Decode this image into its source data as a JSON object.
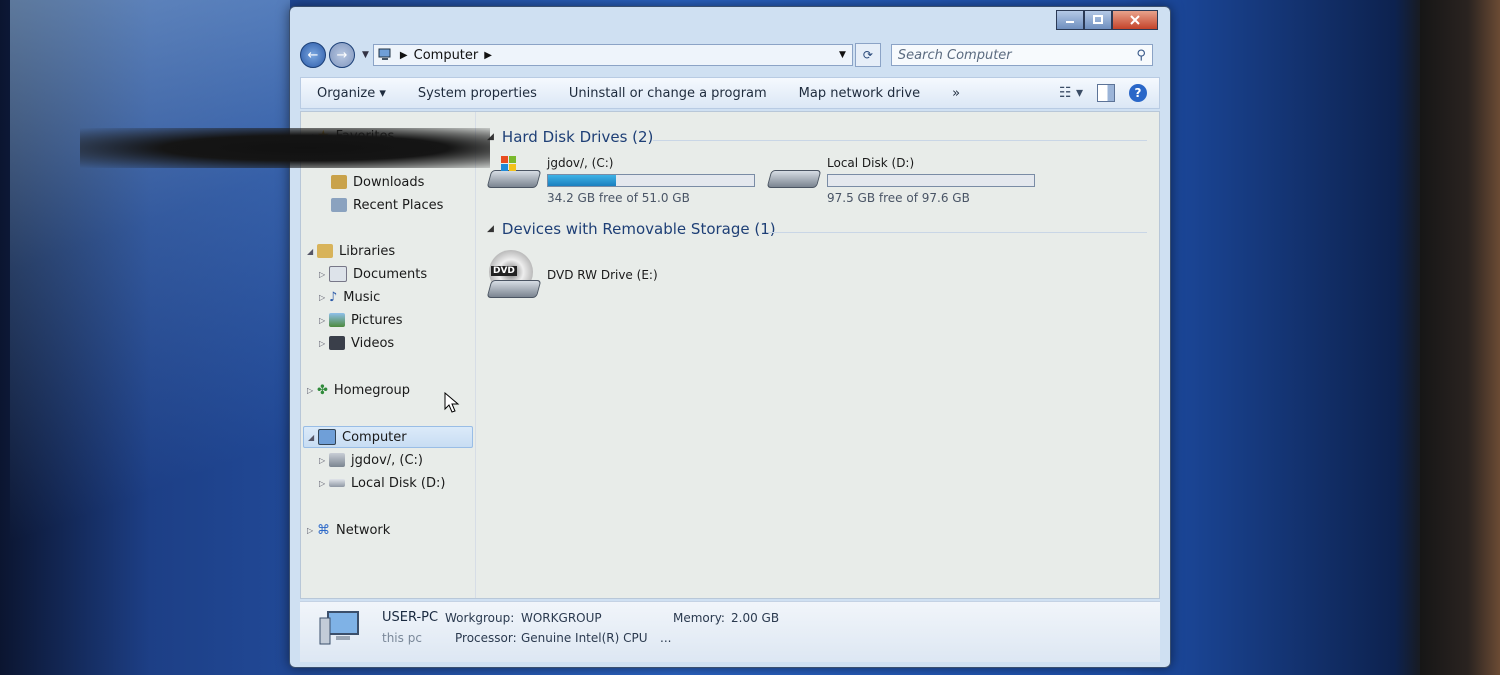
{
  "window": {
    "address": {
      "root_label": "Computer"
    },
    "search_placeholder": "Search Computer"
  },
  "toolbar": {
    "items": [
      "Organize",
      "System properties",
      "Uninstall or change a program",
      "Map network drive"
    ],
    "overflow": "»",
    "help": "?"
  },
  "navpane": {
    "favorites": {
      "label": "Favorites",
      "items": [
        "Downloads",
        "Recent Places"
      ]
    },
    "libraries": {
      "label": "Libraries",
      "items": [
        "Documents",
        "Music",
        "Pictures",
        "Videos"
      ]
    },
    "homegroup": "Homegroup",
    "computer": {
      "label": "Computer",
      "items": [
        "jgdov/, (C:)",
        "Local Disk (D:)"
      ]
    },
    "network": "Network"
  },
  "groups": {
    "hard_disks": {
      "title": "Hard Disk Drives (2)"
    },
    "removable": {
      "title": "Devices with Removable Storage (1)"
    }
  },
  "drives": [
    {
      "name": "jgdov/, (C:)",
      "free_text": "34.2 GB free of 51.0 GB",
      "used_fraction": 0.33
    },
    {
      "name": "Local Disk (D:)",
      "free_text": "97.5 GB free of 97.6 GB",
      "used_fraction": 0.001
    }
  ],
  "dvd": {
    "name": "DVD RW Drive (E:)",
    "badge": "DVD"
  },
  "details": {
    "pc_name": "USER-PC",
    "pc_subtitle": "this pc",
    "workgroup_label": "Workgroup:",
    "workgroup_value": "WORKGROUP",
    "memory_label": "Memory:",
    "memory_value": "2.00 GB",
    "processor_label": "Processor:",
    "processor_value": "Genuine Intel(R) CPU",
    "processor_more": "..."
  },
  "colors": {
    "accent": "#2a67c8",
    "usage_bar": "#1a7fbf"
  },
  "icons": [
    "back-icon",
    "forward-icon",
    "computer-icon",
    "refresh-icon",
    "search-icon",
    "views-icon",
    "preview-pane-icon",
    "help-icon",
    "star-icon",
    "folder-icon",
    "homegroup-icon",
    "network-icon",
    "hard-disk-icon",
    "dvd-drive-icon",
    "mouse-cursor-icon"
  ]
}
